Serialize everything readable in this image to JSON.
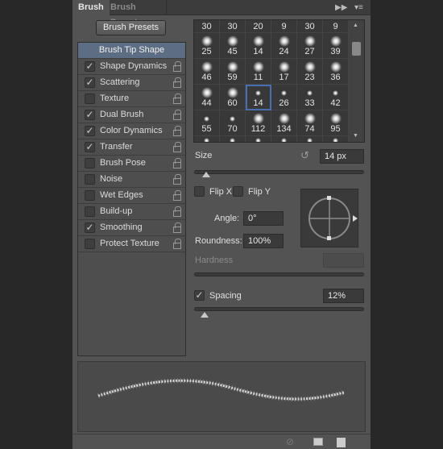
{
  "tabs": [
    {
      "label": "Brush",
      "active": true
    },
    {
      "label": "Brush Presets",
      "active": false
    }
  ],
  "brush_presets_button": "Brush Presets",
  "settings": [
    {
      "label": "Brush Tip Shape",
      "selected": true
    },
    {
      "label": "Shape Dynamics",
      "checked": true
    },
    {
      "label": "Scattering",
      "checked": true
    },
    {
      "label": "Texture",
      "checked": false
    },
    {
      "label": "Dual Brush",
      "checked": true
    },
    {
      "label": "Color Dynamics",
      "checked": true
    },
    {
      "label": "Transfer",
      "checked": true
    },
    {
      "label": "Brush Pose",
      "checked": false
    },
    {
      "label": "Noise",
      "checked": false
    },
    {
      "label": "Wet Edges",
      "checked": false
    },
    {
      "label": "Build-up",
      "checked": false
    },
    {
      "label": "Smoothing",
      "checked": true
    },
    {
      "label": "Protect Texture",
      "checked": false
    }
  ],
  "brush_grid": {
    "header_sizes": [
      "30",
      "30",
      "20",
      "9",
      "30",
      "9"
    ],
    "rows": [
      [
        "25",
        "45",
        "14",
        "24",
        "27",
        "39"
      ],
      [
        "46",
        "59",
        "11",
        "17",
        "23",
        "36"
      ],
      [
        "44",
        "60",
        "14",
        "26",
        "33",
        "42"
      ],
      [
        "55",
        "70",
        "112",
        "134",
        "74",
        "95"
      ]
    ],
    "selected": {
      "row": 2,
      "col": 2
    }
  },
  "size": {
    "label": "Size",
    "value": "14 px",
    "slider_fraction": 0.07
  },
  "flip_x": {
    "label": "Flip X",
    "checked": false
  },
  "flip_y": {
    "label": "Flip Y",
    "checked": false
  },
  "angle": {
    "label": "Angle:",
    "value": "0°"
  },
  "roundness": {
    "label": "Roundness:",
    "value": "100%"
  },
  "hardness": {
    "label": "Hardness",
    "value": ""
  },
  "spacing": {
    "label": "Spacing",
    "checked": true,
    "value": "12%",
    "slider_fraction": 0.06
  },
  "colors": {
    "panel": "#535353",
    "selected_item": "#5d6e84",
    "selected_brush_outline": "#4a6fb0"
  }
}
